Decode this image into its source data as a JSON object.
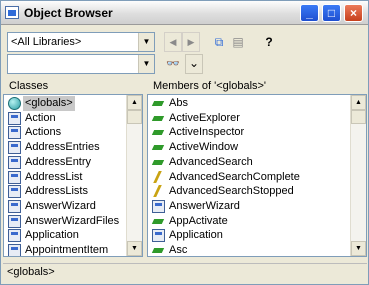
{
  "window": {
    "title": "Object Browser",
    "minimize_glyph": "_",
    "maximize_glyph": "□",
    "close_glyph": "×"
  },
  "toolbar": {
    "library_value": "<All Libraries>",
    "search_value": "",
    "back_glyph": "◀",
    "forward_glyph": "▶",
    "copy_glyph": "⧉",
    "view_glyph": "▤",
    "help_glyph": "?",
    "binoculars_glyph": "👓",
    "toggle_glyph": "⌄",
    "dropdown_glyph": "▼"
  },
  "classes": {
    "header": "Classes",
    "items": [
      {
        "label": "<globals>",
        "icon": "glob",
        "selected": true
      },
      {
        "label": "Action",
        "icon": "cls"
      },
      {
        "label": "Actions",
        "icon": "cls"
      },
      {
        "label": "AddressEntries",
        "icon": "cls"
      },
      {
        "label": "AddressEntry",
        "icon": "cls"
      },
      {
        "label": "AddressList",
        "icon": "cls"
      },
      {
        "label": "AddressLists",
        "icon": "cls"
      },
      {
        "label": "AnswerWizard",
        "icon": "cls"
      },
      {
        "label": "AnswerWizardFiles",
        "icon": "cls"
      },
      {
        "label": "Application",
        "icon": "cls"
      },
      {
        "label": "AppointmentItem",
        "icon": "cls"
      }
    ]
  },
  "members": {
    "header": "Members of '<globals>'",
    "items": [
      {
        "label": "Abs",
        "icon": "member"
      },
      {
        "label": "ActiveExplorer",
        "icon": "member"
      },
      {
        "label": "ActiveInspector",
        "icon": "member"
      },
      {
        "label": "ActiveWindow",
        "icon": "member"
      },
      {
        "label": "AdvancedSearch",
        "icon": "member"
      },
      {
        "label": "AdvancedSearchComplete",
        "icon": "event"
      },
      {
        "label": "AdvancedSearchStopped",
        "icon": "event"
      },
      {
        "label": "AnswerWizard",
        "icon": "cls"
      },
      {
        "label": "AppActivate",
        "icon": "member"
      },
      {
        "label": "Application",
        "icon": "cls"
      },
      {
        "label": "Asc",
        "icon": "member"
      }
    ]
  },
  "status": {
    "text": "<globals>"
  }
}
